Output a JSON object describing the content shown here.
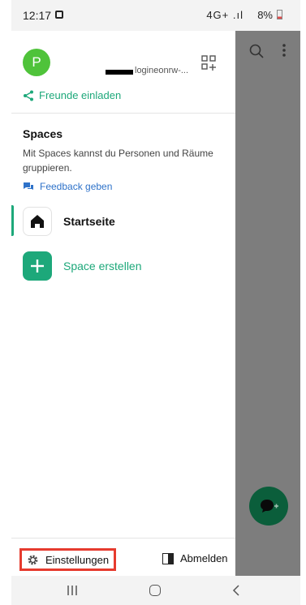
{
  "status": {
    "time": "12:17",
    "signal": "4G+ .ıl",
    "battery": "8%"
  },
  "drawer": {
    "avatar_letter": "P",
    "user_id": "logineonrw-...",
    "invite_label": "Freunde einladen",
    "spaces": {
      "title": "Spaces",
      "description": "Mit Spaces kannst du Personen und Räume gruppieren.",
      "feedback_label": "Feedback geben"
    },
    "items": [
      {
        "label": "Startseite",
        "icon": "home-icon",
        "active": true
      },
      {
        "label": "Space erstellen",
        "icon": "plus-icon",
        "active": false
      }
    ],
    "footer": {
      "settings_label": "Einstellungen",
      "logout_label": "Abmelden"
    }
  },
  "colors": {
    "accent_green": "#1da87a",
    "avatar_green": "#4fc33a",
    "link_blue": "#2e72c9",
    "fab_green": "#0b5e3b",
    "highlight_red": "#e63b2e"
  }
}
